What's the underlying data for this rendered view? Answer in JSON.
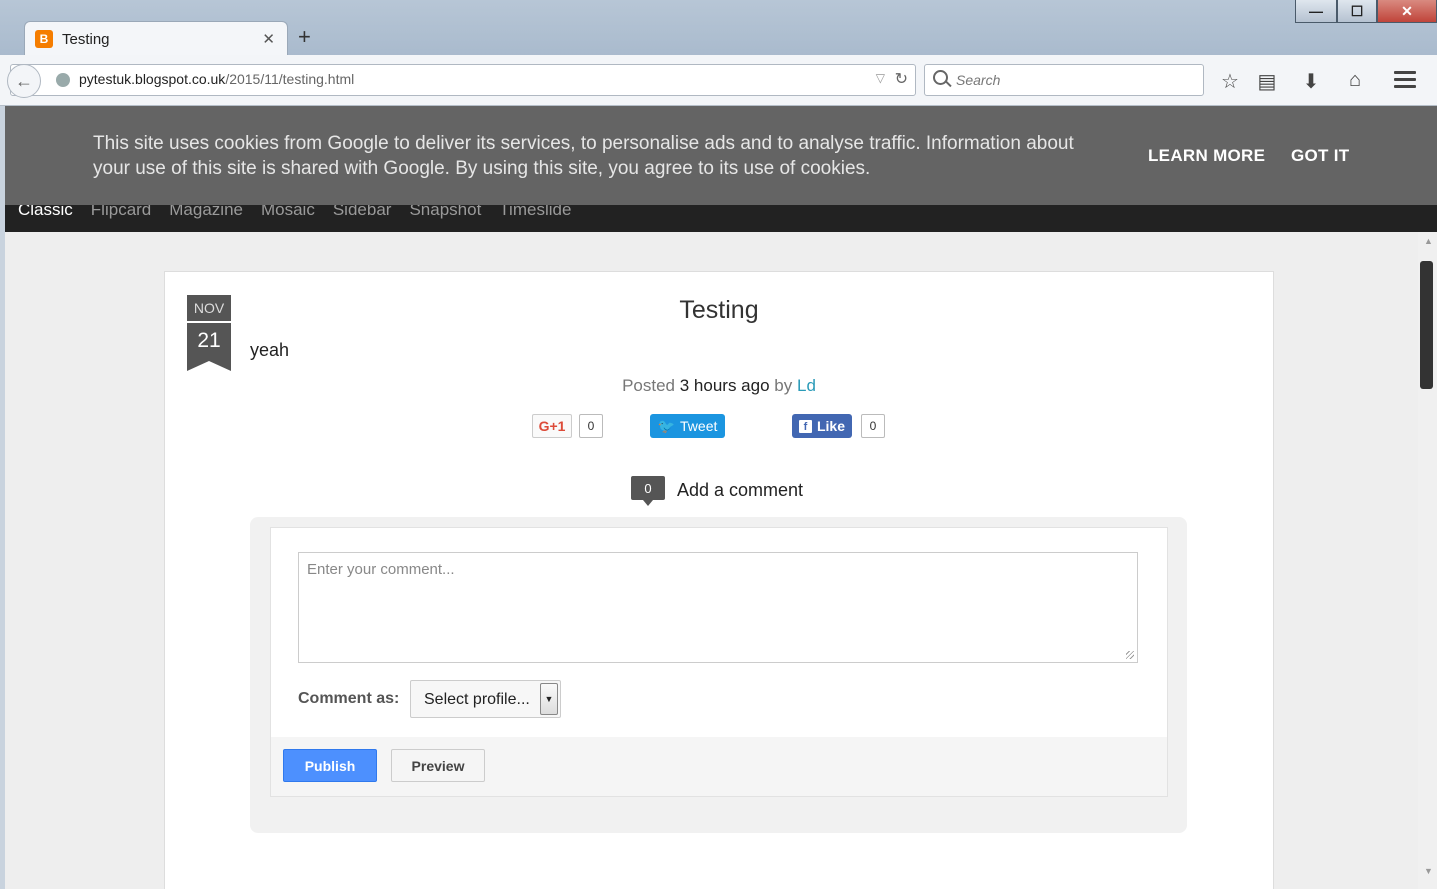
{
  "browser": {
    "tab": {
      "title": "Testing",
      "favicon": "blogger-icon"
    },
    "url": {
      "domain": "pytestuk.blogspot.co.uk",
      "path": "/2015/11/testing.html"
    },
    "search": {
      "placeholder": "Search"
    },
    "window_controls": {
      "minimize": "—",
      "maximize": "☐",
      "close": "✕"
    }
  },
  "cookie_banner": {
    "text": "This site uses cookies from Google to deliver its services, to personalise ads and to analyse traffic. Information about your use of this site is shared with Google. By using this site, you agree to its use of cookies.",
    "learn_more": "LEARN MORE",
    "got_it": "GOT IT"
  },
  "blog_nav": {
    "items": [
      "Classic",
      "Flipcard",
      "Magazine",
      "Mosaic",
      "Sidebar",
      "Snapshot",
      "Timeslide"
    ],
    "active": "Classic"
  },
  "post": {
    "month": "NOV",
    "day": "21",
    "title": "Testing",
    "body": "yeah",
    "meta_prefix": "Posted",
    "meta_time": "3 hours ago",
    "meta_by": "by",
    "author": "Ld"
  },
  "share": {
    "gplus_label": "G+1",
    "gplus_count": "0",
    "tweet_label": "Tweet",
    "like_label": "Like",
    "like_count": "0"
  },
  "comments": {
    "count": "0",
    "add_label": "Add a comment",
    "textarea_placeholder": "Enter your comment...",
    "comment_as_label": "Comment as:",
    "profile_select": "Select profile...",
    "publish_label": "Publish",
    "preview_label": "Preview"
  },
  "colors": {
    "cookie_bg": "#646464",
    "nav_bg": "#222222",
    "publish_blue": "#4d90fe",
    "author_link": "#2a9bb8"
  }
}
